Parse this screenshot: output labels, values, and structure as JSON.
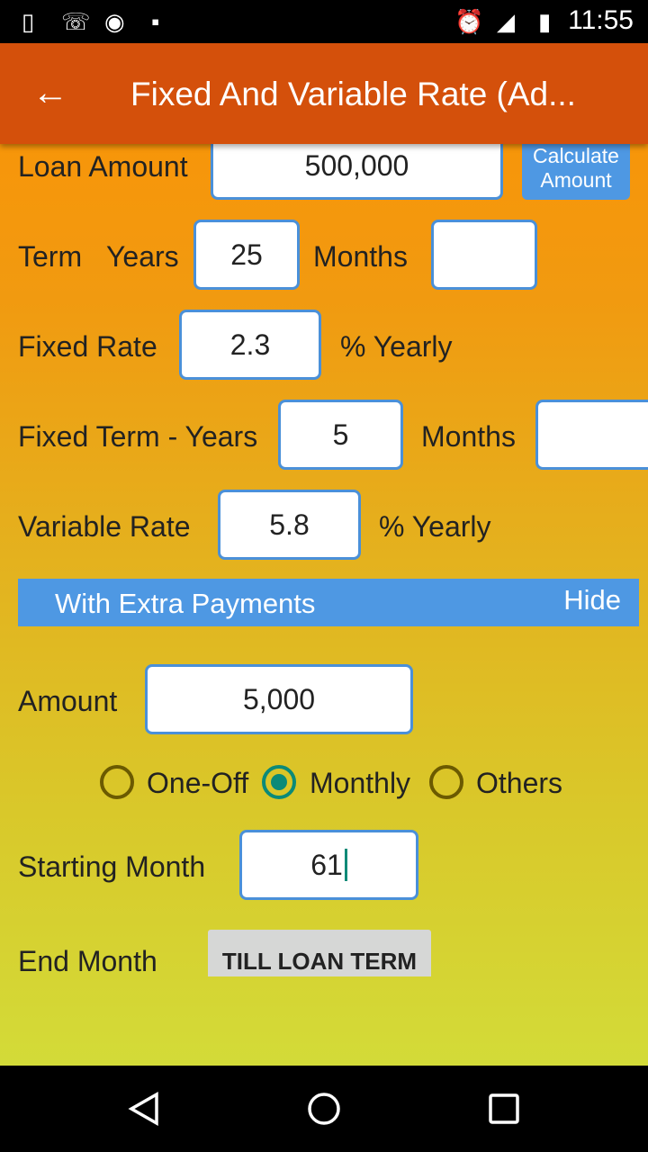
{
  "status_bar": {
    "icons": [
      "phone-sync-icon",
      "missed-call-icon",
      "disc-alert-icon",
      "android-icon",
      "alarm-icon",
      "signal-icon",
      "battery-charging-icon"
    ],
    "time": "11:55"
  },
  "app_bar": {
    "title": "Fixed And Variable Rate (Ad...",
    "back_icon": "arrow-left-icon"
  },
  "form": {
    "loan_amount_label": "Loan Amount",
    "loan_amount": "500,000",
    "calculate_label": "Calculate Amount",
    "term_label": "Term",
    "years_label": "Years",
    "term_years": "25",
    "months_label": "Months",
    "term_months": "",
    "fixed_rate_label": "Fixed Rate",
    "fixed_rate": "2.3",
    "yearly_label": "% Yearly",
    "fixed_term_label": "Fixed Term - Years",
    "fixed_term_years": "5",
    "fixed_term_months_label": "Months",
    "fixed_term_months": "",
    "variable_rate_label": "Variable Rate",
    "variable_rate": "5.8",
    "variable_yearly_label": "% Yearly"
  },
  "extra": {
    "header": "With Extra Payments",
    "hide_label": "Hide",
    "amount_label": "Amount",
    "amount": "5,000",
    "frequency_options": [
      "One-Off",
      "Monthly",
      "Others"
    ],
    "frequency_selected": "Monthly",
    "starting_month_label": "Starting Month",
    "starting_month": "61",
    "end_month_label": "End Month",
    "end_month_button": "TILL LOAN TERM"
  },
  "colors": {
    "app_bar": "#d4500b",
    "accent": "#4e98e3",
    "radio_selected": "#0b8a78"
  }
}
